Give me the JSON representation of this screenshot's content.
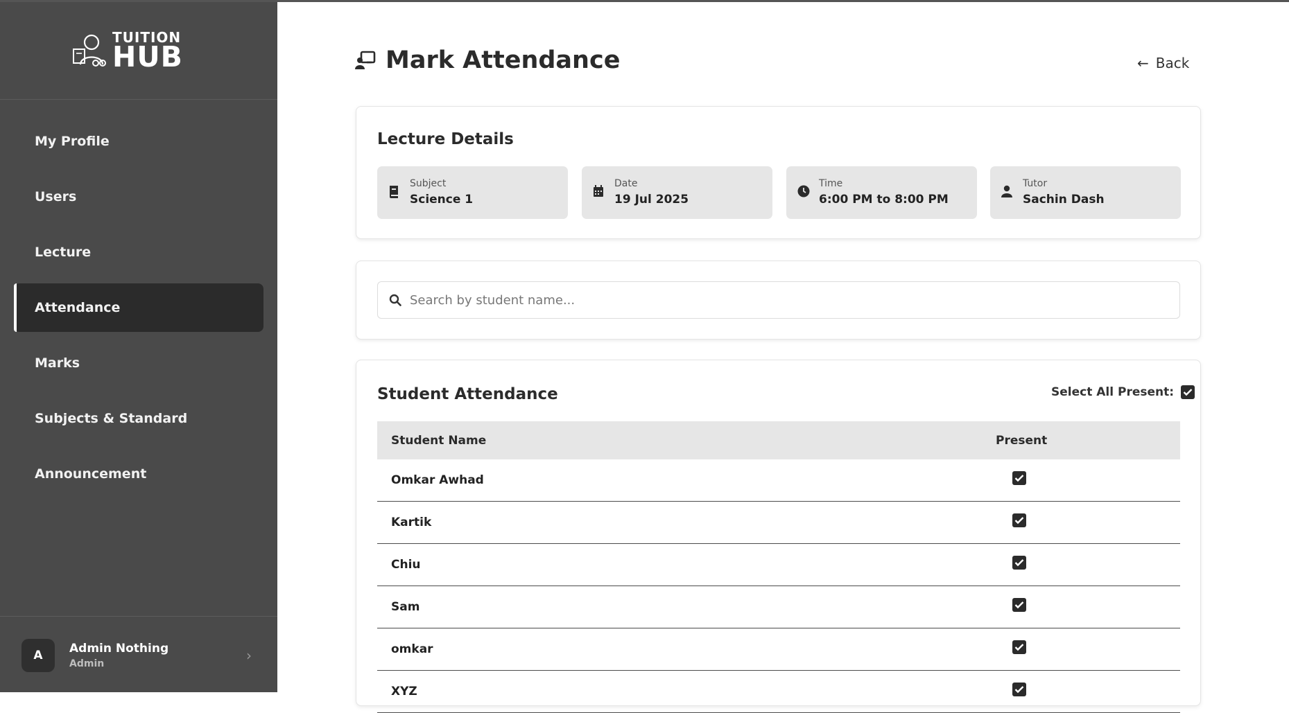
{
  "brand": {
    "line1": "TUITION",
    "line2": "HUB"
  },
  "sidebar": {
    "items": [
      {
        "label": "My Profile"
      },
      {
        "label": "Users"
      },
      {
        "label": "Lecture"
      },
      {
        "label": "Attendance",
        "active": true
      },
      {
        "label": "Marks"
      },
      {
        "label": "Subjects & Standard"
      },
      {
        "label": "Announcement"
      }
    ],
    "user": {
      "initial": "A",
      "name": "Admin Nothing",
      "role": "Admin"
    }
  },
  "header": {
    "title": "Mark Attendance",
    "back_label": "Back"
  },
  "lecture": {
    "title": "Lecture Details",
    "subject": {
      "label": "Subject",
      "value": "Science 1",
      "icon": "book-icon"
    },
    "date": {
      "label": "Date",
      "value": "19 Jul 2025",
      "icon": "calendar-icon"
    },
    "time": {
      "label": "Time",
      "value": "6:00 PM to 8:00 PM",
      "icon": "clock-icon"
    },
    "tutor": {
      "label": "Tutor",
      "value": "Sachin Dash",
      "icon": "person-icon"
    }
  },
  "search": {
    "placeholder": "Search by student name...",
    "value": ""
  },
  "attendance": {
    "title": "Student Attendance",
    "select_all_label": "Select All Present:",
    "select_all_checked": true,
    "columns": [
      "Student Name",
      "Present"
    ],
    "rows": [
      {
        "name": "Omkar Awhad",
        "present": true
      },
      {
        "name": "Kartik",
        "present": true
      },
      {
        "name": "Chiu",
        "present": true
      },
      {
        "name": "Sam",
        "present": true
      },
      {
        "name": "omkar",
        "present": true
      },
      {
        "name": "XYZ",
        "present": true
      }
    ]
  },
  "colors": {
    "sidebar_bg": "#4a4a4a",
    "active_item_bg": "#2b2b2b",
    "accent": "#2b2b2b"
  }
}
